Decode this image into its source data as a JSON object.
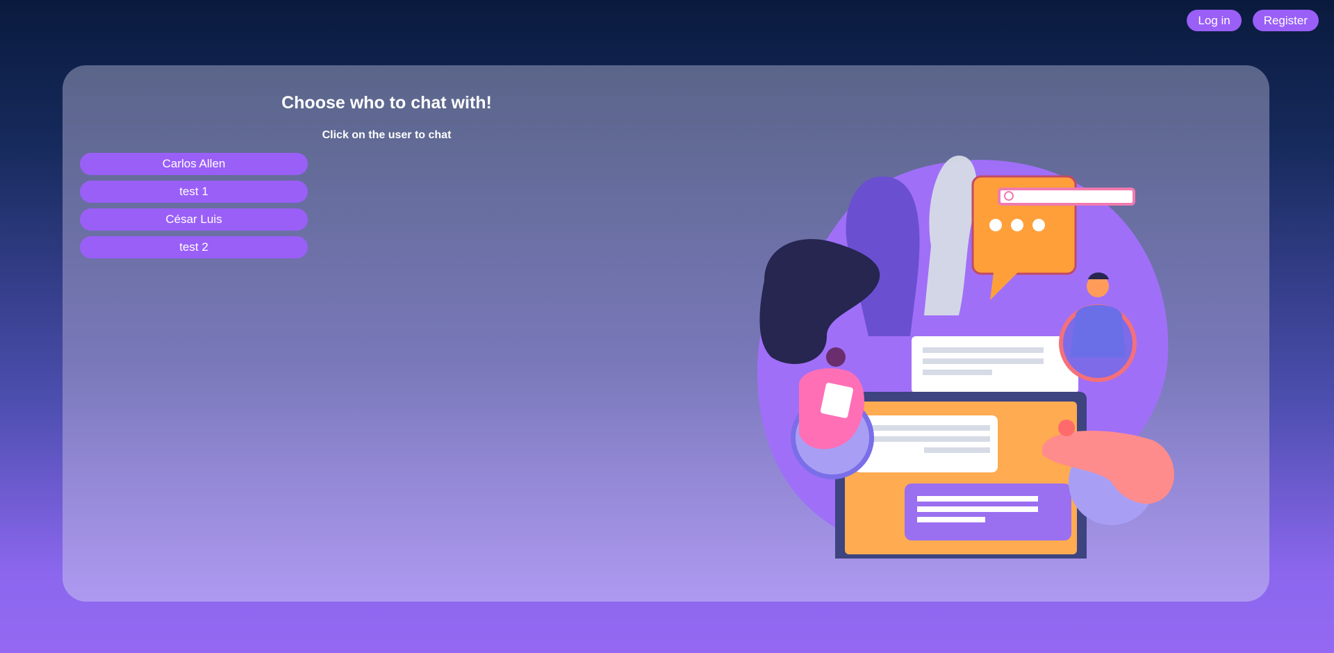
{
  "nav": {
    "login_label": "Log in",
    "register_label": "Register"
  },
  "main": {
    "title": "Choose who to chat with!",
    "subtitle": "Click on the user to chat",
    "users": [
      {
        "name": "Carlos Allen"
      },
      {
        "name": "test 1"
      },
      {
        "name": "César Luis"
      },
      {
        "name": "test 2"
      }
    ]
  },
  "colors": {
    "accent": "#9a5ff7",
    "background_top": "#0a1a3e",
    "background_bottom": "#9468f2"
  },
  "illustration": {
    "icon": "chat-illustration"
  }
}
